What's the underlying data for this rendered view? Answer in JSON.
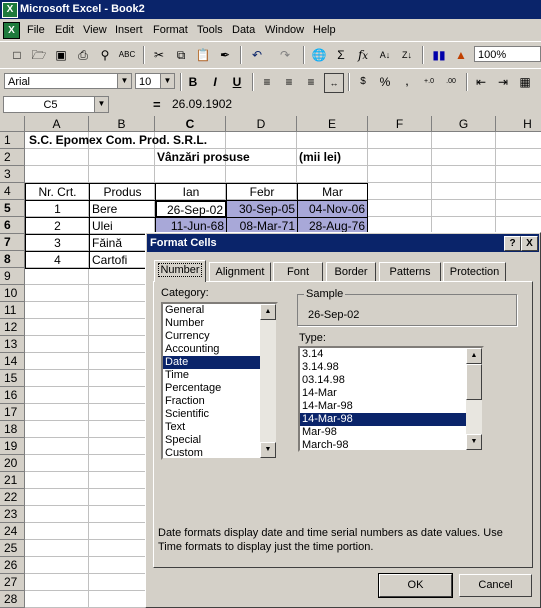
{
  "titlebar": {
    "title": "Microsoft Excel - Book2"
  },
  "menu": [
    "File",
    "Edit",
    "View",
    "Insert",
    "Format",
    "Tools",
    "Data",
    "Window",
    "Help"
  ],
  "toolbar": {
    "zoom": "100%",
    "font": "Arial",
    "size": "10"
  },
  "formula": {
    "cellref": "C5",
    "equals": "=",
    "value": "26.09.1902"
  },
  "columns": [
    "A",
    "B",
    "C",
    "D",
    "E",
    "F",
    "G",
    "H"
  ],
  "rows": [
    "1",
    "2",
    "3",
    "4",
    "5",
    "6",
    "7",
    "8",
    "9",
    "10",
    "11",
    "12",
    "13",
    "14",
    "15",
    "16",
    "17",
    "18",
    "19",
    "20",
    "21",
    "22",
    "23",
    "24",
    "25",
    "26",
    "27",
    "28"
  ],
  "sheet": {
    "company": "S.C. Epomex Com. Prod. S.R.L.",
    "subtitle": "Vânzări prosuse",
    "unit": "(mii lei)",
    "headers": [
      "Nr. Crt.",
      "Produs",
      "Ian",
      "Febr",
      "Mar"
    ],
    "data": [
      [
        "1",
        "Bere",
        "26-Sep-02",
        "30-Sep-05",
        "04-Nov-06"
      ],
      [
        "2",
        "Ulei",
        "11-Jun-68",
        "08-Mar-71",
        "28-Aug-76"
      ],
      [
        "3",
        "Făină",
        "",
        "",
        ""
      ],
      [
        "4",
        "Cartofi",
        "",
        "",
        ""
      ]
    ]
  },
  "dialog": {
    "title": "Format Cells",
    "help": "?",
    "close": "X",
    "tabs": [
      "Number",
      "Alignment",
      "Font",
      "Border",
      "Patterns",
      "Protection"
    ],
    "category_label": "Category:",
    "categories": [
      "General",
      "Number",
      "Currency",
      "Accounting",
      "Date",
      "Time",
      "Percentage",
      "Fraction",
      "Scientific",
      "Text",
      "Special",
      "Custom"
    ],
    "selected_category": "Date",
    "sample_label": "Sample",
    "sample_value": "26-Sep-02",
    "type_label": "Type:",
    "types": [
      "3.14",
      "3.14.98",
      "03.14.98",
      "14-Mar",
      "14-Mar-98",
      "14-Mar-98",
      "Mar-98",
      "March-98"
    ],
    "selected_type_index": 5,
    "description": "Date formats display date and time serial numbers as date values.  Use Time formats to display just the time portion.",
    "ok": "OK",
    "cancel": "Cancel"
  }
}
